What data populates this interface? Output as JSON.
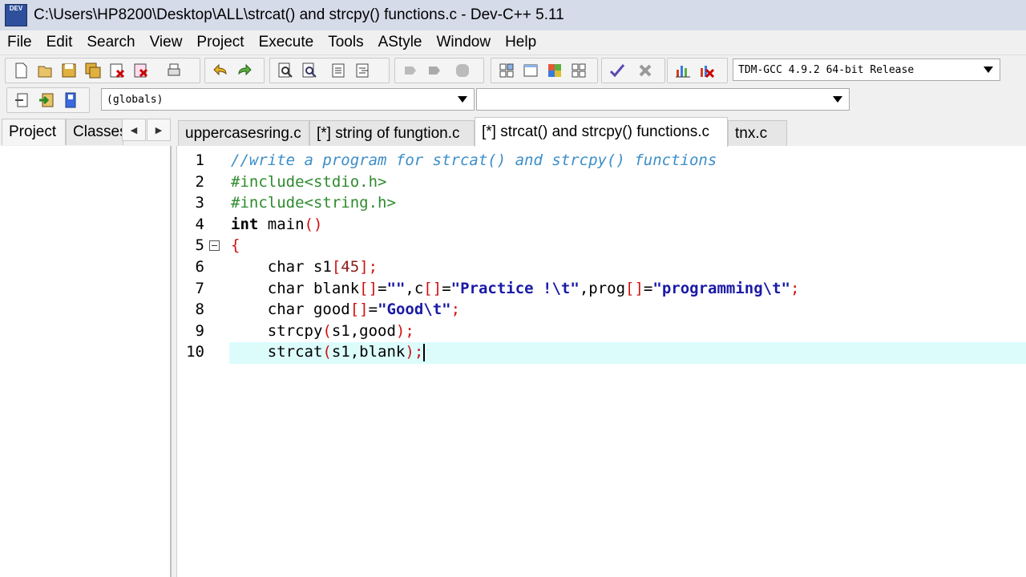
{
  "window": {
    "title": "C:\\Users\\HP8200\\Desktop\\ALL\\strcat() and strcpy() functions.c - Dev-C++ 5.11",
    "logo_text": "DEV"
  },
  "menu": [
    "File",
    "Edit",
    "Search",
    "View",
    "Project",
    "Execute",
    "Tools",
    "AStyle",
    "Window",
    "Help"
  ],
  "toolbar": {
    "compiler": "TDM-GCC 4.9.2 64-bit Release",
    "scope": "(globals)",
    "member": ""
  },
  "left_tabs": [
    "Project",
    "Classes"
  ],
  "file_tabs": [
    "uppercasesring.c",
    "[*] string of fungtion.c",
    "[*] strcat() and strcpy() functions.c",
    "tnx.c"
  ],
  "active_tab_index": 2,
  "editor": {
    "line_numbers": [
      "1",
      "2",
      "3",
      "4",
      "5",
      "6",
      "7",
      "8",
      "9",
      "10"
    ],
    "current_line": 10,
    "lines": [
      "//write a program for strcat() and strcpy() functions",
      "#include<stdio.h>",
      "#include<string.h>",
      "int main()",
      "{",
      "    char s1[45];",
      "    char blank[]=\"\",c[]=\"Practice !\\t\",prog[]=\"programming\\t\";",
      "    char good[]=\"Good\\t\";",
      "    strcpy(s1,good);",
      "    strcat(s1,blank);"
    ]
  },
  "colors": {
    "comment": "#3c8ec8",
    "preprocessor": "#2e8b2e",
    "symbol": "#d01010",
    "string": "#1a1aa6",
    "current_line": "#dcfcfc"
  }
}
